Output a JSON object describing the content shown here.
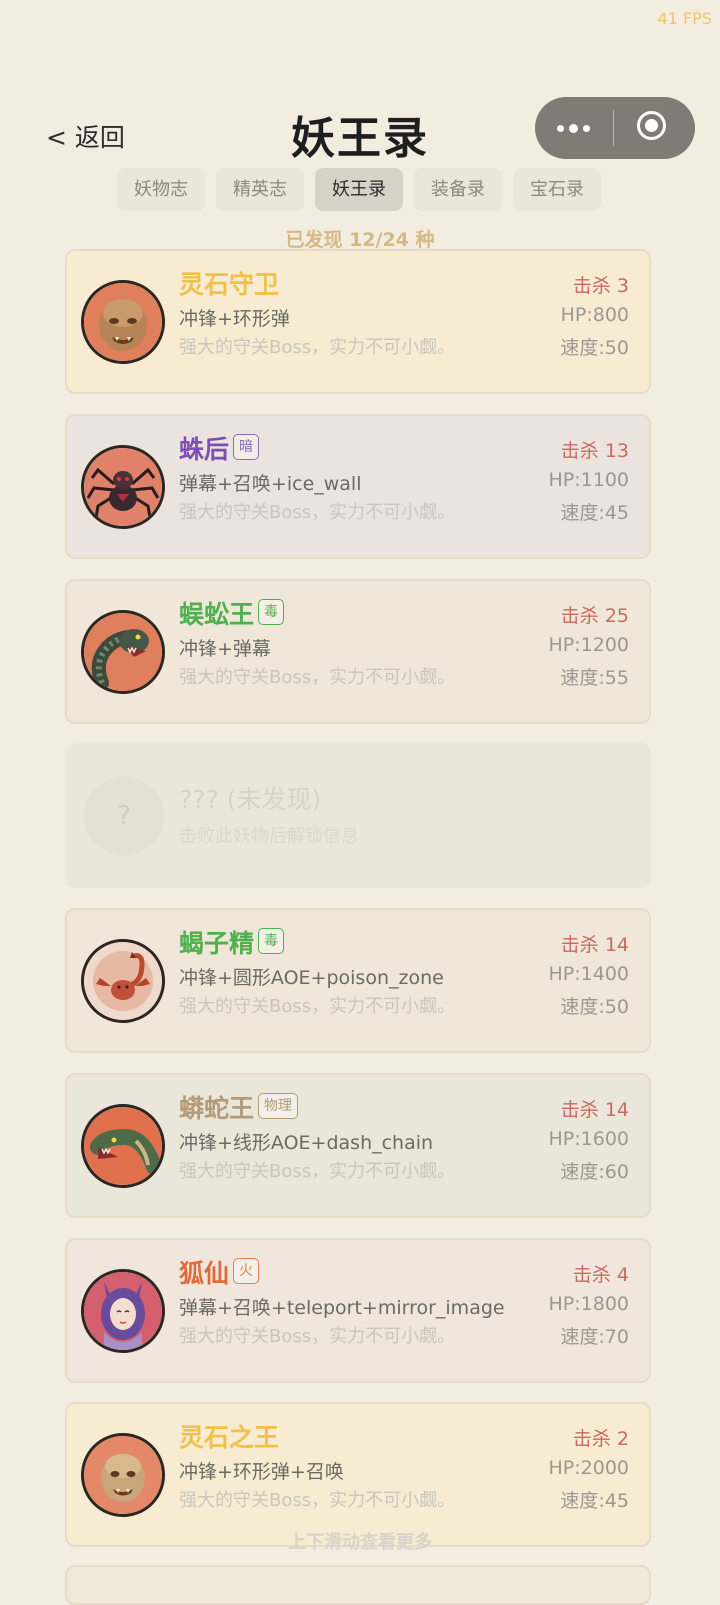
{
  "status": {
    "fps": "41 FPS"
  },
  "header": {
    "back_label": "< 返回",
    "title": "妖王录"
  },
  "tabs": [
    {
      "label": "妖物志",
      "active": false
    },
    {
      "label": "精英志",
      "active": false
    },
    {
      "label": "妖王录",
      "active": true
    },
    {
      "label": "装备录",
      "active": false
    },
    {
      "label": "宝石录",
      "active": false
    }
  ],
  "discovered_text": "已发现 12/24 种",
  "bosses": [
    {
      "name": "灵石守卫",
      "badge": "",
      "skills": "冲锋+环形弹",
      "desc": "强大的守关Boss，实力不可小觑。",
      "kills": "击杀 3",
      "hp": "HP:800",
      "speed": "速度:50",
      "name_color": "#f0c14a",
      "card_bg": "#f7ecd2",
      "avatar_icon": "stone-guardian-icon"
    },
    {
      "name": "蛛后",
      "badge": "暗",
      "skills": "弹幕+召唤+ice_wall",
      "desc": "强大的守关Boss，实力不可小觑。",
      "kills": "击杀 13",
      "hp": "HP:1100",
      "speed": "速度:45",
      "name_color": "#7d4fb2",
      "badge_color": "#8c6bbd",
      "card_bg": "#ebe4de",
      "avatar_icon": "spider-icon"
    },
    {
      "name": "蜈蚣王",
      "badge": "毒",
      "skills": "冲锋+弹幕",
      "desc": "强大的守关Boss，实力不可小觑。",
      "kills": "击杀 25",
      "hp": "HP:1200",
      "speed": "速度:55",
      "name_color": "#4fb04f",
      "badge_color": "#4fb04f",
      "card_bg": "#f0e7d9",
      "avatar_icon": "centipede-icon"
    },
    {
      "name": "蝎子精",
      "badge": "毒",
      "skills": "冲锋+圆形AOE+poison_zone",
      "desc": "强大的守关Boss，实力不可小觑。",
      "kills": "击杀 14",
      "hp": "HP:1400",
      "speed": "速度:50",
      "name_color": "#4fb04f",
      "badge_color": "#4fb04f",
      "card_bg": "#f0e7d9",
      "avatar_icon": "scorpion-icon"
    },
    {
      "name": "蟒蛇王",
      "badge": "物理",
      "skills": "冲锋+线形AOE+dash_chain",
      "desc": "强大的守关Boss，实力不可小觑。",
      "kills": "击杀 14",
      "hp": "HP:1600",
      "speed": "速度:60",
      "name_color": "#b39a78",
      "badge_color": "#b39a78",
      "card_bg": "#ebe6da",
      "avatar_icon": "serpent-icon"
    },
    {
      "name": "狐仙",
      "badge": "火",
      "skills": "弹幕+召唤+teleport+mirror_image",
      "desc": "强大的守关Boss，实力不可小觑。",
      "kills": "击杀 4",
      "hp": "HP:1800",
      "speed": "速度:70",
      "name_color": "#e06a3a",
      "badge_color": "#e0814f",
      "card_bg": "#f1e6dd",
      "avatar_icon": "fox-spirit-icon"
    },
    {
      "name": "灵石之王",
      "badge": "",
      "skills": "冲锋+环形弹+召唤",
      "desc": "强大的守关Boss，实力不可小觑。",
      "kills": "击杀 2",
      "hp": "HP:2000",
      "speed": "速度:45",
      "name_color": "#f0c14a",
      "card_bg": "#f7ecd2",
      "avatar_icon": "stone-king-icon"
    }
  ],
  "locked_entry": {
    "icon": "?",
    "title": "??? (未发现)",
    "hint": "击败此妖物后解锁信息"
  },
  "scroll_hint": "上下滑动查看更多"
}
